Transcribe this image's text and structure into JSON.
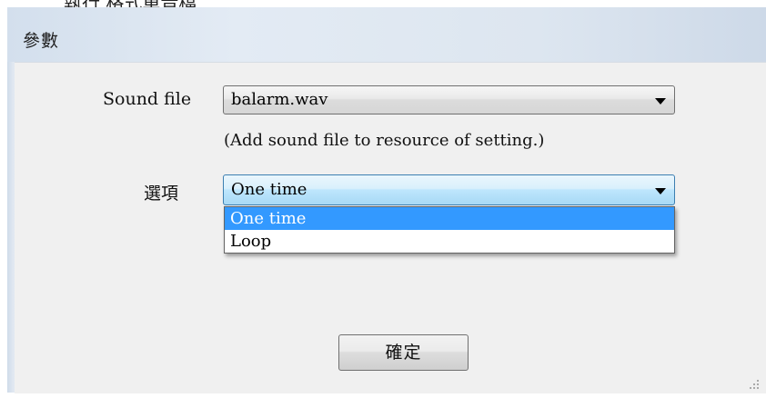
{
  "window": {
    "background_title": "執行 格式單音檔",
    "title": "參數"
  },
  "sound_file": {
    "label": "Sound file",
    "value": "balarm.wav",
    "hint": "(Add sound file to resource of setting.)"
  },
  "option": {
    "label": "選項",
    "value": "One time",
    "options": [
      "One time",
      "Loop"
    ],
    "highlighted_option": "One time"
  },
  "ok_button": {
    "label": "確定"
  },
  "colors": {
    "selection_highlight": "#3399ff",
    "dialog_background": "#f0f0f0",
    "focus_border": "#3c7fb1"
  },
  "icons": {
    "dropdown": "chevron-down-icon",
    "resize": "resize-grip-icon"
  }
}
